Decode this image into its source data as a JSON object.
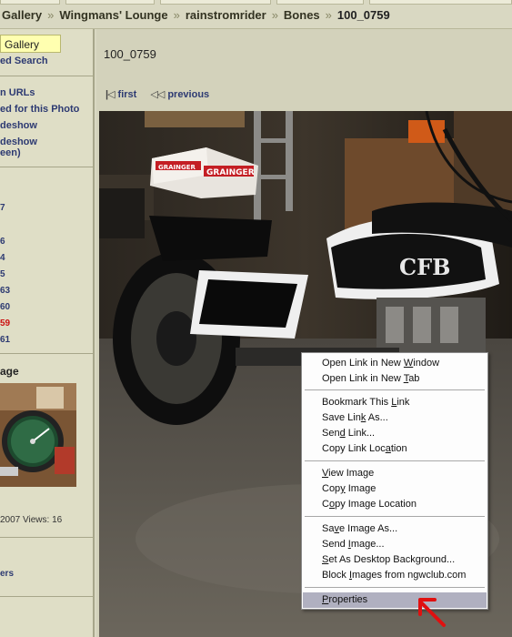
{
  "breadcrumb": {
    "items": [
      "Gallery",
      "Wingmans' Lounge",
      "rainstromrider",
      "Bones",
      "100_0759"
    ]
  },
  "sidebar": {
    "gallery_button": "Gallery",
    "advanced_search": "ed Search",
    "links": [
      "n URLs",
      "ed for this Photo",
      "deshow",
      "deshow",
      "een)"
    ],
    "numbers": [
      "7",
      "6",
      "4",
      "5",
      "63",
      "60",
      "59",
      "61"
    ],
    "current_number": "59",
    "random_image_heading": "age",
    "random_image_meta": "2007 Views: 16",
    "bottom_link": "ers"
  },
  "main": {
    "photo_title": "100_0759",
    "nav_first": "first",
    "nav_previous": "previous"
  },
  "context_menu": {
    "items": [
      {
        "pre": "Open Link in New ",
        "u": "W",
        "post": "indow"
      },
      {
        "pre": "Open Link in New ",
        "u": "T",
        "post": "ab"
      },
      {
        "pre": "Bookmark This ",
        "u": "L",
        "post": "ink"
      },
      {
        "pre": "Save Lin",
        "u": "k",
        "post": " As..."
      },
      {
        "pre": "Sen",
        "u": "d",
        "post": " Link..."
      },
      {
        "pre": "Copy Link Loc",
        "u": "a",
        "post": "tion"
      },
      {
        "pre": "",
        "u": "V",
        "post": "iew Image"
      },
      {
        "pre": "Cop",
        "u": "y",
        "post": " Image"
      },
      {
        "pre": "C",
        "u": "o",
        "post": "py Image Location"
      },
      {
        "pre": "Sa",
        "u": "v",
        "post": "e Image As..."
      },
      {
        "pre": "Send ",
        "u": "I",
        "post": "mage..."
      },
      {
        "pre": "",
        "u": "S",
        "post": "et As Desktop Background..."
      },
      {
        "pre": "Block ",
        "u": "I",
        "post": "mages from ngwclub.com"
      },
      {
        "pre": "",
        "u": "P",
        "post": "roperties"
      }
    ]
  },
  "photo": {
    "box_text_1": "GRAINGER",
    "box_text_2": "GRAINGER",
    "tank_logo": "CFB"
  },
  "colors": {
    "link": "#2d3a72",
    "current": "#cc1111",
    "menu_highlight": "#b0b0c0",
    "arrow": "#e01010"
  }
}
